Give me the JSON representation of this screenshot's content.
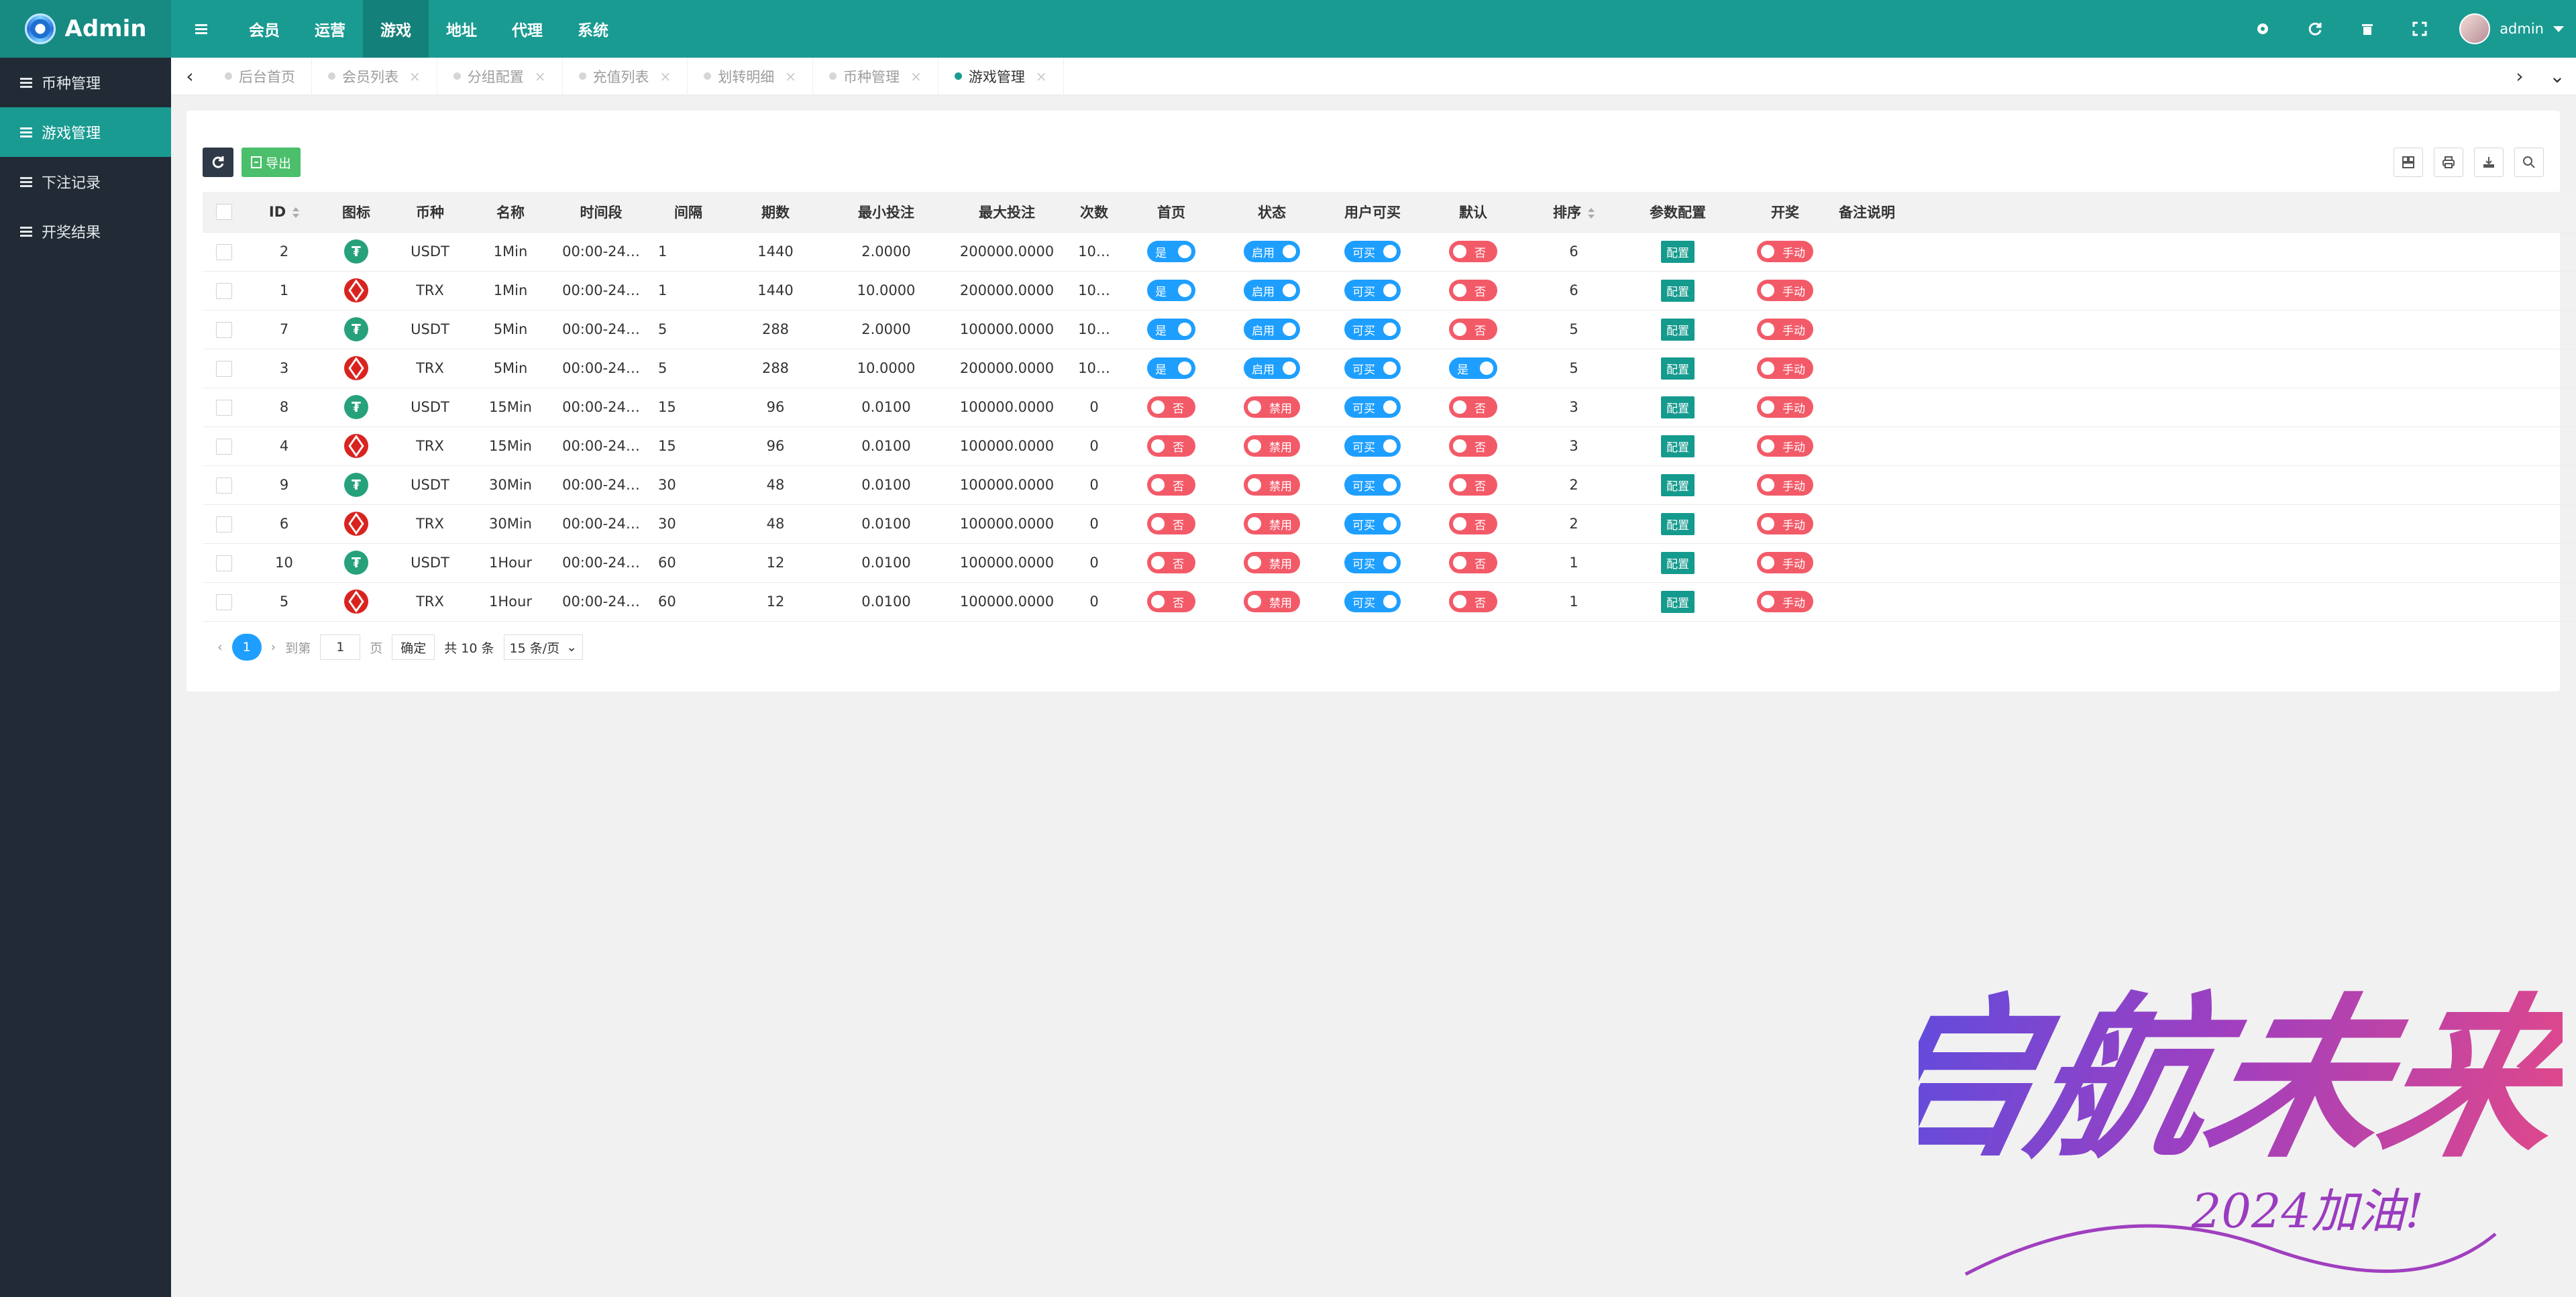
{
  "app": {
    "brand": "Admin"
  },
  "topnav": [
    "会员",
    "运营",
    "游戏",
    "地址",
    "代理",
    "系统"
  ],
  "topnav_active": "游戏",
  "user": {
    "name": "admin"
  },
  "sidebar": [
    {
      "label": "币种管理",
      "active": false
    },
    {
      "label": "游戏管理",
      "active": true
    },
    {
      "label": "下注记录",
      "active": false
    },
    {
      "label": "开奖结果",
      "active": false
    }
  ],
  "tabs": [
    {
      "label": "后台首页",
      "closable": false
    },
    {
      "label": "会员列表",
      "closable": true
    },
    {
      "label": "分组配置",
      "closable": true
    },
    {
      "label": "充值列表",
      "closable": true
    },
    {
      "label": "划转明细",
      "closable": true
    },
    {
      "label": "币种管理",
      "closable": true
    },
    {
      "label": "游戏管理",
      "closable": true,
      "active": true
    }
  ],
  "toolbar": {
    "export_label": "导出"
  },
  "table": {
    "headers": [
      "ID",
      "图标",
      "币种",
      "名称",
      "时间段",
      "间隔",
      "期数",
      "最小投注",
      "最大投注",
      "次数",
      "首页",
      "状态",
      "用户可买",
      "默认",
      "排序",
      "参数配置",
      "开奖",
      "备注说明"
    ],
    "rows": [
      {
        "id": "2",
        "coin": "USDT",
        "name": "1Min",
        "period": "00:00-24…",
        "interval": "1",
        "issues": "1440",
        "min": "2.0000",
        "max": "200000.0000",
        "times": "10…",
        "home": "是",
        "status": "启用",
        "buyable": "可买",
        "default": "否",
        "sort": "6",
        "config": "配置",
        "draw": "手动"
      },
      {
        "id": "1",
        "coin": "TRX",
        "name": "1Min",
        "period": "00:00-24…",
        "interval": "1",
        "issues": "1440",
        "min": "10.0000",
        "max": "200000.0000",
        "times": "10…",
        "home": "是",
        "status": "启用",
        "buyable": "可买",
        "default": "否",
        "sort": "6",
        "config": "配置",
        "draw": "手动"
      },
      {
        "id": "7",
        "coin": "USDT",
        "name": "5Min",
        "period": "00:00-24…",
        "interval": "5",
        "issues": "288",
        "min": "2.0000",
        "max": "100000.0000",
        "times": "10…",
        "home": "是",
        "status": "启用",
        "buyable": "可买",
        "default": "否",
        "sort": "5",
        "config": "配置",
        "draw": "手动"
      },
      {
        "id": "3",
        "coin": "TRX",
        "name": "5Min",
        "period": "00:00-24…",
        "interval": "5",
        "issues": "288",
        "min": "10.0000",
        "max": "200000.0000",
        "times": "10…",
        "home": "是",
        "status": "启用",
        "buyable": "可买",
        "default": "是",
        "sort": "5",
        "config": "配置",
        "draw": "手动"
      },
      {
        "id": "8",
        "coin": "USDT",
        "name": "15Min",
        "period": "00:00-24…",
        "interval": "15",
        "issues": "96",
        "min": "0.0100",
        "max": "100000.0000",
        "times": "0",
        "home": "否",
        "status": "禁用",
        "buyable": "可买",
        "default": "否",
        "sort": "3",
        "config": "配置",
        "draw": "手动"
      },
      {
        "id": "4",
        "coin": "TRX",
        "name": "15Min",
        "period": "00:00-24…",
        "interval": "15",
        "issues": "96",
        "min": "0.0100",
        "max": "100000.0000",
        "times": "0",
        "home": "否",
        "status": "禁用",
        "buyable": "可买",
        "default": "否",
        "sort": "3",
        "config": "配置",
        "draw": "手动"
      },
      {
        "id": "9",
        "coin": "USDT",
        "name": "30Min",
        "period": "00:00-24…",
        "interval": "30",
        "issues": "48",
        "min": "0.0100",
        "max": "100000.0000",
        "times": "0",
        "home": "否",
        "status": "禁用",
        "buyable": "可买",
        "default": "否",
        "sort": "2",
        "config": "配置",
        "draw": "手动"
      },
      {
        "id": "6",
        "coin": "TRX",
        "name": "30Min",
        "period": "00:00-24…",
        "interval": "30",
        "issues": "48",
        "min": "0.0100",
        "max": "100000.0000",
        "times": "0",
        "home": "否",
        "status": "禁用",
        "buyable": "可买",
        "default": "否",
        "sort": "2",
        "config": "配置",
        "draw": "手动"
      },
      {
        "id": "10",
        "coin": "USDT",
        "name": "1Hour",
        "period": "00:00-24…",
        "interval": "60",
        "issues": "12",
        "min": "0.0100",
        "max": "100000.0000",
        "times": "0",
        "home": "否",
        "status": "禁用",
        "buyable": "可买",
        "default": "否",
        "sort": "1",
        "config": "配置",
        "draw": "手动"
      },
      {
        "id": "5",
        "coin": "TRX",
        "name": "1Hour",
        "period": "00:00-24…",
        "interval": "60",
        "issues": "12",
        "min": "0.0100",
        "max": "100000.0000",
        "times": "0",
        "home": "否",
        "status": "禁用",
        "buyable": "可买",
        "default": "否",
        "sort": "1",
        "config": "配置",
        "draw": "手动"
      }
    ]
  },
  "pagination": {
    "current": "1",
    "goto_label": "到第",
    "page_input": "1",
    "page_unit": "页",
    "confirm": "确定",
    "total": "共 10 条",
    "page_size": "15 条/页"
  },
  "watermark": {
    "main": "启航未来",
    "sub": "2024加油!"
  },
  "colors": {
    "header": "#1a9b92",
    "sidebar": "#222b35",
    "switch_on": "#1e9fff",
    "switch_off": "#f35a68",
    "config_btn": "#159a8e"
  }
}
